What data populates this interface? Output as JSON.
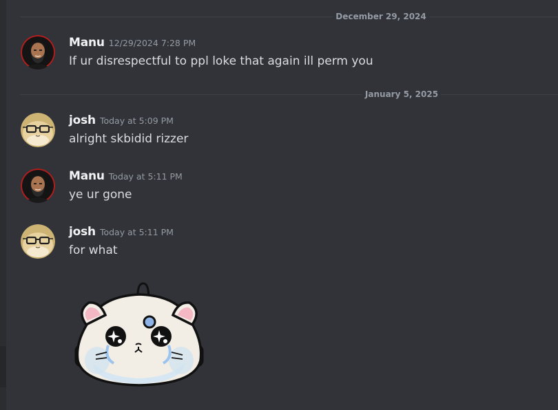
{
  "dividers": [
    {
      "label": "December 29, 2024"
    },
    {
      "label": "January 5, 2025"
    }
  ],
  "messages": [
    {
      "author": "Manu",
      "timestamp": "12/29/2024 7:28 PM",
      "text": "If ur disrespectful to ppl loke that again ill perm you",
      "avatar_icon": "bearded-man-avatar"
    },
    {
      "author": "josh",
      "timestamp": "Today at 5:09 PM",
      "text": "alright skbidid rizzer",
      "avatar_icon": "glasses-hamster-avatar"
    },
    {
      "author": "Manu",
      "timestamp": "Today at 5:11 PM",
      "text": "ye ur gone",
      "avatar_icon": "bearded-man-avatar"
    },
    {
      "author": "josh",
      "timestamp": "Today at 5:11 PM",
      "text": "for what",
      "avatar_icon": "glasses-hamster-avatar",
      "sticker_icon": "crying-hamster-sticker"
    }
  ],
  "colors": {
    "background": "#313338",
    "sidebar": "#2b2d31",
    "username": "#f2f3f5",
    "message_text": "#dbdee1",
    "muted_text": "#949ba4",
    "divider_line": "#3f4147"
  }
}
